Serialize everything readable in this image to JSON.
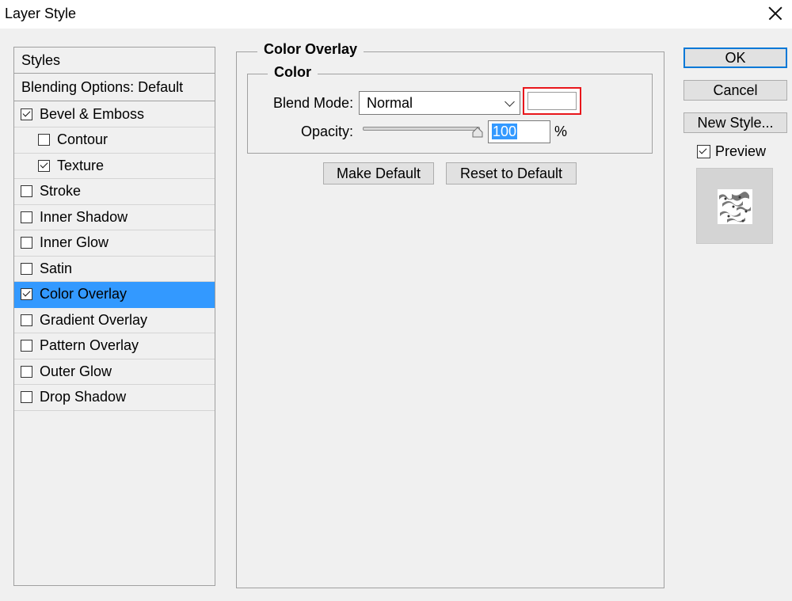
{
  "window": {
    "title": "Layer Style"
  },
  "styles_panel": {
    "header": "Styles",
    "blending_options": "Blending Options: Default",
    "items": [
      {
        "label": "Bevel & Emboss",
        "checked": true,
        "indent": false,
        "selected": false
      },
      {
        "label": "Contour",
        "checked": false,
        "indent": true,
        "selected": false
      },
      {
        "label": "Texture",
        "checked": true,
        "indent": true,
        "selected": false
      },
      {
        "label": "Stroke",
        "checked": false,
        "indent": false,
        "selected": false
      },
      {
        "label": "Inner Shadow",
        "checked": false,
        "indent": false,
        "selected": false
      },
      {
        "label": "Inner Glow",
        "checked": false,
        "indent": false,
        "selected": false
      },
      {
        "label": "Satin",
        "checked": false,
        "indent": false,
        "selected": false
      },
      {
        "label": "Color Overlay",
        "checked": true,
        "indent": false,
        "selected": true
      },
      {
        "label": "Gradient Overlay",
        "checked": false,
        "indent": false,
        "selected": false
      },
      {
        "label": "Pattern Overlay",
        "checked": false,
        "indent": false,
        "selected": false
      },
      {
        "label": "Outer Glow",
        "checked": false,
        "indent": false,
        "selected": false
      },
      {
        "label": "Drop Shadow",
        "checked": false,
        "indent": false,
        "selected": false
      }
    ]
  },
  "color_overlay": {
    "title": "Color Overlay",
    "color_group_title": "Color",
    "blend_mode_label": "Blend Mode:",
    "blend_mode_value": "Normal",
    "overlay_color": "#ffffff",
    "highlight_color": "#e8161b",
    "opacity_label": "Opacity:",
    "opacity_value": "100",
    "opacity_unit": "%",
    "opacity_fraction": 1.0,
    "make_default_label": "Make Default",
    "reset_default_label": "Reset to Default"
  },
  "actions": {
    "ok_label": "OK",
    "cancel_label": "Cancel",
    "new_style_label": "New Style...",
    "preview_label": "Preview",
    "preview_checked": true
  },
  "colors": {
    "selection": "#3399ff",
    "dialog_bg": "#f0f0f0",
    "focus_border": "#0078d7"
  }
}
